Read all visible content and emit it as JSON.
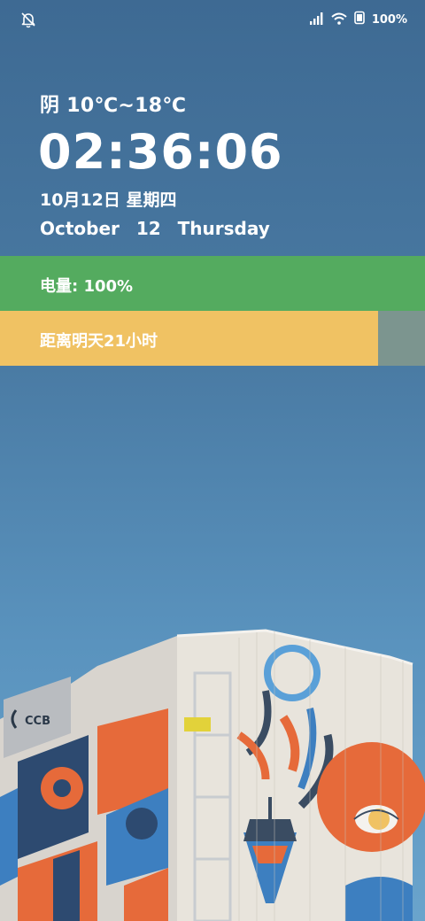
{
  "status_bar": {
    "left_icon": "bell-muted-icon",
    "signal_icon": "signal-icon",
    "wifi_icon": "wifi-icon",
    "battery_icon": "battery-icon",
    "battery_text": "100%"
  },
  "widget": {
    "weather": "阴 10℃~18℃",
    "time": "02:36:06",
    "date_cn": "10月12日 星期四",
    "date_en": "October 12 Thursday"
  },
  "battery_bar": {
    "label": "电量: 100%",
    "color": "#54ab5f",
    "level": 1.0
  },
  "countdown_bar": {
    "label": "距离明天21小时",
    "fill_color": "#f0c263",
    "track_color": "#7c958f",
    "progress": 0.89
  },
  "wallpaper": {
    "sign_text": "CCB"
  }
}
